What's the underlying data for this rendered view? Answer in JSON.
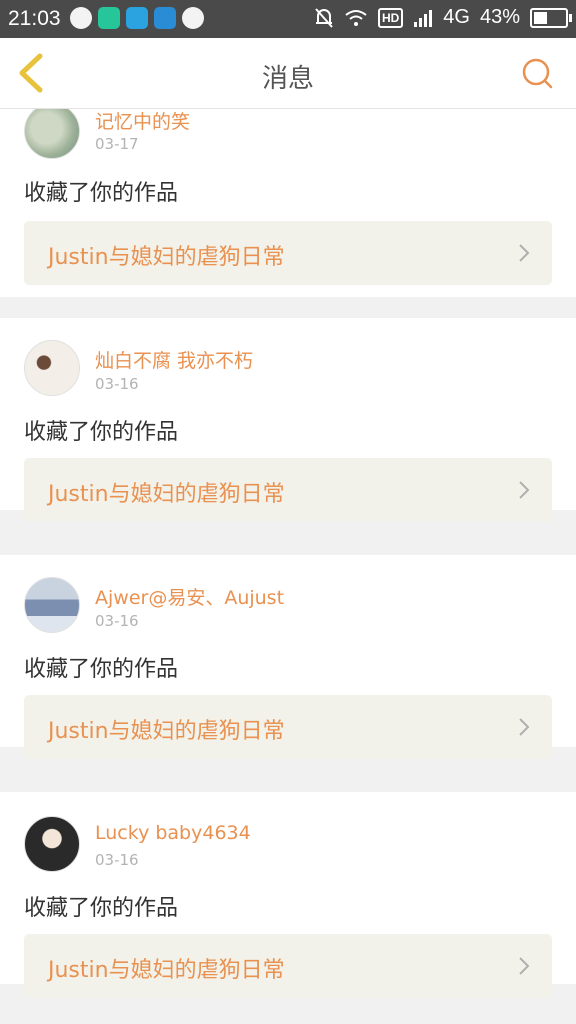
{
  "status_bar": {
    "time": "21:03",
    "network": "4G",
    "battery": "43%",
    "battery_level": 0.43,
    "hd_label": "HD"
  },
  "header": {
    "title": "消息"
  },
  "colors": {
    "accent": "#e99150",
    "back_arrow": "#e7c23a",
    "link_bg": "#f2f2ea"
  },
  "messages": [
    {
      "username": "记忆中的笑",
      "date": "03-17",
      "action": "收藏了你的作品",
      "work_title": "Justin与媳妇的虐狗日常"
    },
    {
      "username": "灿白不腐 我亦不朽",
      "date": "03-16",
      "action": "收藏了你的作品",
      "work_title": "Justin与媳妇的虐狗日常"
    },
    {
      "username": "Ajwer@易安、Aujust",
      "date": "03-16",
      "action": "收藏了你的作品",
      "work_title": "Justin与媳妇的虐狗日常"
    },
    {
      "username": "Lucky baby4634",
      "date": "03-16",
      "action": "收藏了你的作品",
      "work_title": "Justin与媳妇的虐狗日常"
    }
  ]
}
